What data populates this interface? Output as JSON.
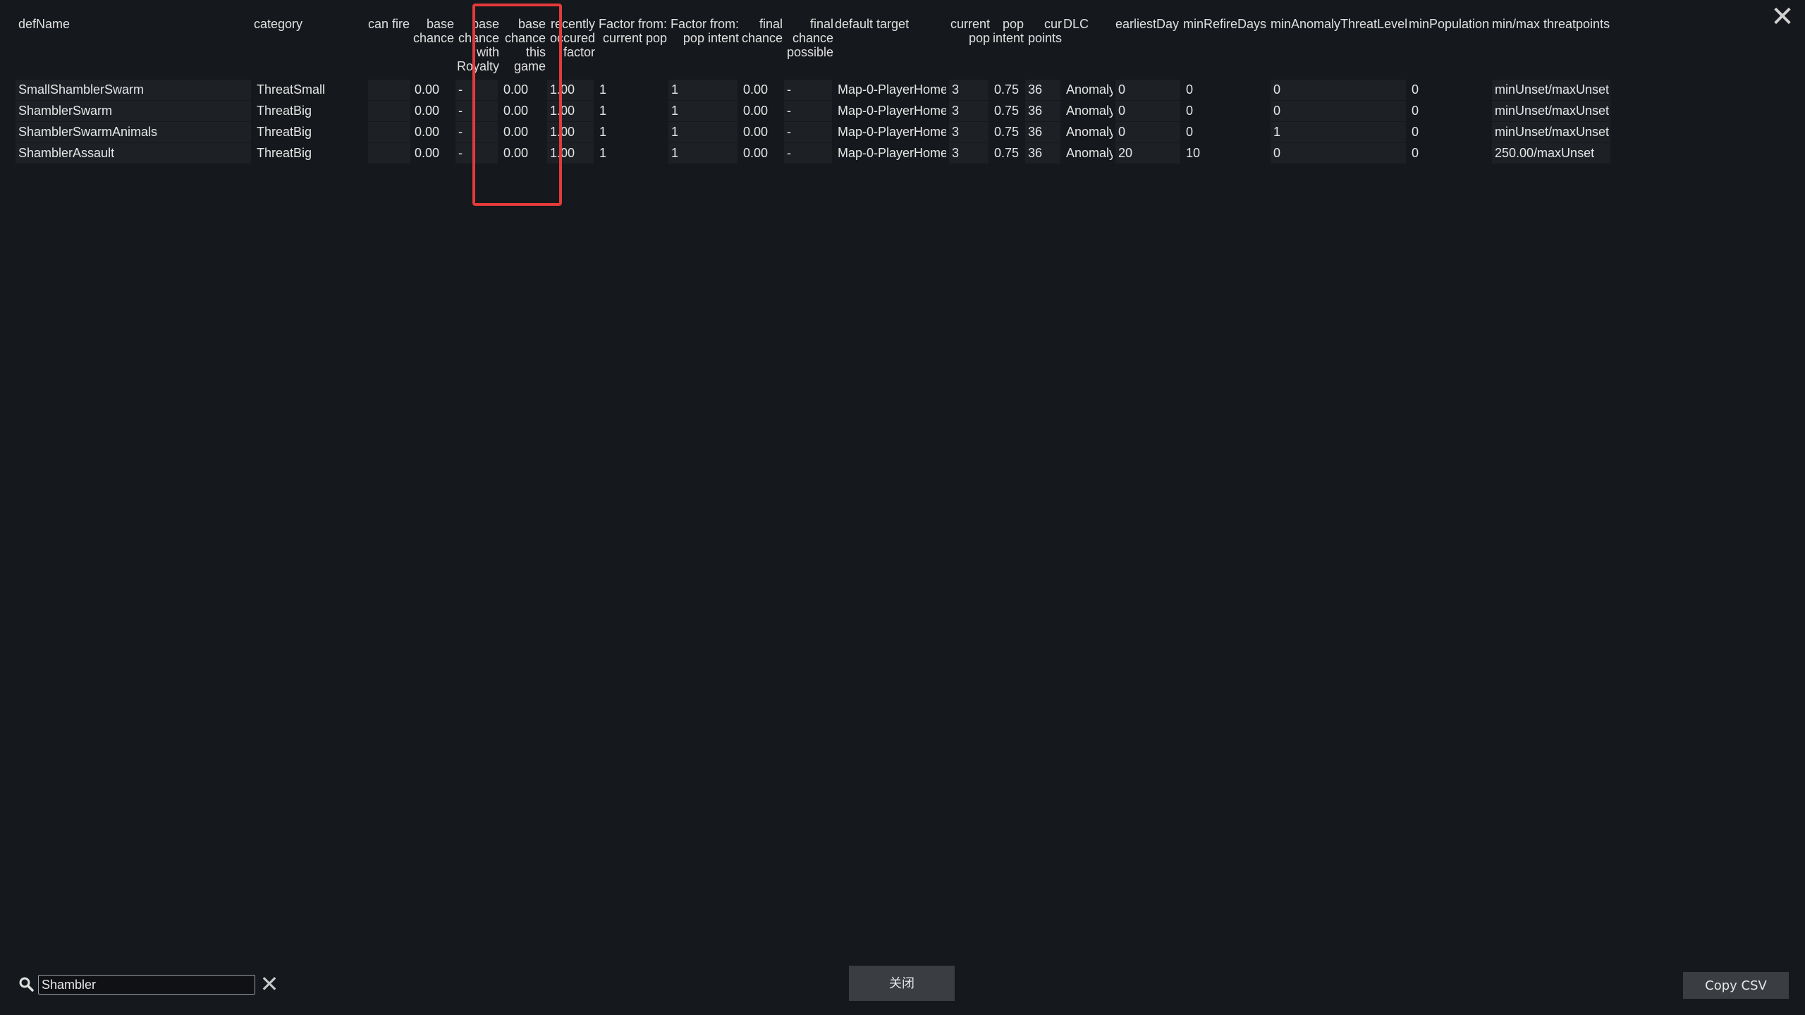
{
  "window": {
    "close_glyph": "✕"
  },
  "columns": [
    {
      "key": "defName",
      "label": "defName"
    },
    {
      "key": "category",
      "label": "category"
    },
    {
      "key": "canFire",
      "label": "can fire"
    },
    {
      "key": "baseChance",
      "label": "base\nchance"
    },
    {
      "key": "baseChanceRoyalty",
      "label": "base\nchance\nwith\nRoyalty"
    },
    {
      "key": "baseChanceThisGame",
      "label": "base\nchance\nthis\ngame"
    },
    {
      "key": "recentlyOccured",
      "label": "recently\noccured\nfactor"
    },
    {
      "key": "factorCurrentPop",
      "label": "Factor from:\ncurrent pop"
    },
    {
      "key": "factorPopIntent",
      "label": "Factor from:\npop intent"
    },
    {
      "key": "finalChance",
      "label": "final\nchance"
    },
    {
      "key": "finalChancePossible",
      "label": "final\nchance\npossible"
    },
    {
      "key": "defaultTarget",
      "label": "default target"
    },
    {
      "key": "currentPop",
      "label": "current\npop"
    },
    {
      "key": "popIntent",
      "label": "pop\nintent"
    },
    {
      "key": "curPoints",
      "label": "cur\npoints"
    },
    {
      "key": "dlc",
      "label": "DLC"
    },
    {
      "key": "earliestDay",
      "label": "earliestDay"
    },
    {
      "key": "minRefireDays",
      "label": "minRefireDays"
    },
    {
      "key": "minAnomalyThreatLevel",
      "label": "minAnomalyThreatLevel"
    },
    {
      "key": "minPopulation",
      "label": "minPopulation"
    },
    {
      "key": "minMaxThreatpoints",
      "label": "min/max threatpoints"
    }
  ],
  "rows": [
    [
      "SmallShamblerSwarm",
      "ThreatSmall",
      "",
      "0.00",
      "-",
      "0.00",
      "1.00",
      "1",
      "1",
      "0.00",
      "-",
      "Map-0-PlayerHome",
      "3",
      "0.75",
      "36",
      "Anomaly",
      "0",
      "0",
      "0",
      "0",
      "minUnset/maxUnset"
    ],
    [
      "ShamblerSwarm",
      "ThreatBig",
      "",
      "0.00",
      "-",
      "0.00",
      "1.00",
      "1",
      "1",
      "0.00",
      "-",
      "Map-0-PlayerHome",
      "3",
      "0.75",
      "36",
      "Anomaly",
      "0",
      "0",
      "0",
      "0",
      "minUnset/maxUnset"
    ],
    [
      "ShamblerSwarmAnimals",
      "ThreatBig",
      "",
      "0.00",
      "-",
      "0.00",
      "1.00",
      "1",
      "1",
      "0.00",
      "-",
      "Map-0-PlayerHome",
      "3",
      "0.75",
      "36",
      "Anomaly",
      "0",
      "0",
      "1",
      "0",
      "minUnset/maxUnset"
    ],
    [
      "ShamblerAssault",
      "ThreatBig",
      "",
      "0.00",
      "-",
      "0.00",
      "1.00",
      "1",
      "1",
      "0.00",
      "-",
      "Map-0-PlayerHome",
      "3",
      "0.75",
      "36",
      "Anomaly",
      "20",
      "10",
      "0",
      "0",
      "250.00/maxUnset"
    ]
  ],
  "search": {
    "value": "Shambler",
    "clear_glyph": "✕"
  },
  "buttons": {
    "close_label": "关闭",
    "copy_csv_label": "Copy CSV"
  },
  "colors": {
    "background": "#15181c",
    "highlight": "#e53a3a",
    "button": "#3a3d42"
  }
}
